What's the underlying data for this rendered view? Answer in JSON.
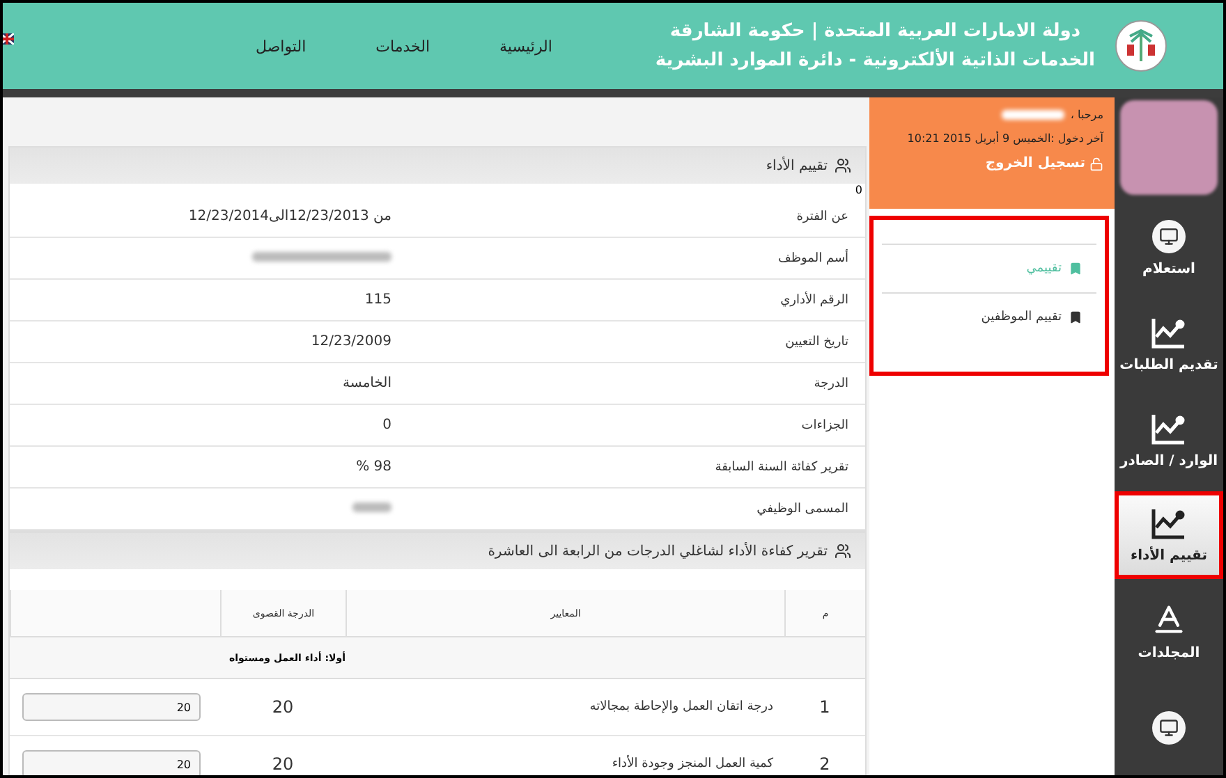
{
  "header": {
    "title": "دولة الامارات العربية المتحدة | حكومة الشارقة",
    "subtitle": "الخدمات الذاتية الألكترونية - دائرة الموارد البشرية",
    "nav": [
      {
        "label": "الرئيسية"
      },
      {
        "label": "الخدمات"
      },
      {
        "label": "التواصل"
      }
    ]
  },
  "user_panel": {
    "greeting": "مرحبا ،",
    "last_login": "آخر دخول :الخميس 9 أبريل 2015 10:21",
    "logout": "تسجيل الخروج"
  },
  "menu": {
    "highlighted": true,
    "items": [
      {
        "label": "تقييمي",
        "selected": true
      },
      {
        "label": "تقييم الموظفين",
        "selected": false
      }
    ]
  },
  "sidebar": {
    "items": [
      {
        "kind": "monitor",
        "label": "استعلام",
        "selected": false,
        "highlighted": false
      },
      {
        "kind": "chart",
        "label": "تقديم الطلبات",
        "selected": false,
        "highlighted": false
      },
      {
        "kind": "chart",
        "label": "الوارد / الصادر",
        "selected": false,
        "highlighted": false
      },
      {
        "kind": "chart",
        "label": "تقييم الأداء",
        "selected": true,
        "highlighted": true
      },
      {
        "kind": "font",
        "label": "المجلدات",
        "selected": false,
        "highlighted": false
      },
      {
        "kind": "monitor",
        "selected": false,
        "highlighted": false
      }
    ]
  },
  "evaluation": {
    "title": "تقييم الأداء",
    "marker": "0",
    "fields": [
      {
        "label": "عن الفترة",
        "value": "من 12/23/2013الى12/23/2014",
        "blurred": false
      },
      {
        "label": "أسم الموظف",
        "blurred": true
      },
      {
        "label": "الرقم الأداري",
        "value": "115",
        "blurred": false
      },
      {
        "label": "تاريخ التعيين",
        "value": "12/23/2009",
        "blurred": false
      },
      {
        "label": "الدرجة",
        "value": "الخامسة",
        "blurred": false
      },
      {
        "label": "الجزاءات",
        "value": "0",
        "blurred": false
      },
      {
        "label": "تقرير كفائة السنة السابقة",
        "value": "98 %",
        "blurred": false
      },
      {
        "label": "المسمى الوظيفي",
        "blurred": true
      }
    ]
  },
  "report": {
    "title": "تقرير كفاءة الأداء لشاغلي الدرجات من الرابعة الى العاشرة",
    "columns": [
      "م",
      "المعايير",
      "الدرجة القصوى"
    ],
    "section": "أولا: أداء العمل ومستواه",
    "rows": [
      {
        "number": "1",
        "criterion": "درجة اتقان العمل والإحاطة بمجالاته",
        "max": "20",
        "score": "20"
      },
      {
        "number": "2",
        "criterion": "كمية العمل المنجز وجودة الأداء",
        "max": "20",
        "score": "20"
      }
    ]
  }
}
